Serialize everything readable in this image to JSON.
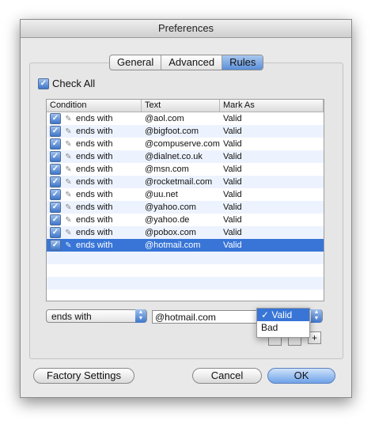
{
  "window": {
    "title": "Preferences"
  },
  "tabs": [
    {
      "label": "General"
    },
    {
      "label": "Advanced"
    },
    {
      "label": "Rules"
    }
  ],
  "check_all": {
    "label": "Check All",
    "checked": true
  },
  "table": {
    "headers": [
      "Condition",
      "Text",
      "Mark As"
    ],
    "rows": [
      {
        "condition": "ends with",
        "text": "@aol.com",
        "mark": "Valid",
        "checked": true
      },
      {
        "condition": "ends with",
        "text": "@bigfoot.com",
        "mark": "Valid",
        "checked": true
      },
      {
        "condition": "ends with",
        "text": "@compuserve.com",
        "mark": "Valid",
        "checked": true
      },
      {
        "condition": "ends with",
        "text": "@dialnet.co.uk",
        "mark": "Valid",
        "checked": true
      },
      {
        "condition": "ends with",
        "text": "@msn.com",
        "mark": "Valid",
        "checked": true
      },
      {
        "condition": "ends with",
        "text": "@rocketmail.com",
        "mark": "Valid",
        "checked": true
      },
      {
        "condition": "ends with",
        "text": "@uu.net",
        "mark": "Valid",
        "checked": true
      },
      {
        "condition": "ends with",
        "text": "@yahoo.com",
        "mark": "Valid",
        "checked": true
      },
      {
        "condition": "ends with",
        "text": "@yahoo.de",
        "mark": "Valid",
        "checked": true
      },
      {
        "condition": "ends with",
        "text": "@pobox.com",
        "mark": "Valid",
        "checked": true
      },
      {
        "condition": "ends with",
        "text": "@hotmail.com",
        "mark": "Valid",
        "checked": true
      }
    ],
    "selected_row": 10
  },
  "editor": {
    "condition_value": "ends with",
    "text_value": "@hotmail.com",
    "mark_menu": {
      "options": [
        {
          "label": "✓ Valid"
        },
        {
          "label": "Bad"
        }
      ]
    },
    "add_label": "+"
  },
  "buttons": {
    "factory": "Factory Settings",
    "cancel": "Cancel",
    "ok": "OK"
  },
  "colors": {
    "selection": "#3875d7",
    "alt_row": "#edf3fe",
    "active_tab": "#5b8fd8"
  }
}
